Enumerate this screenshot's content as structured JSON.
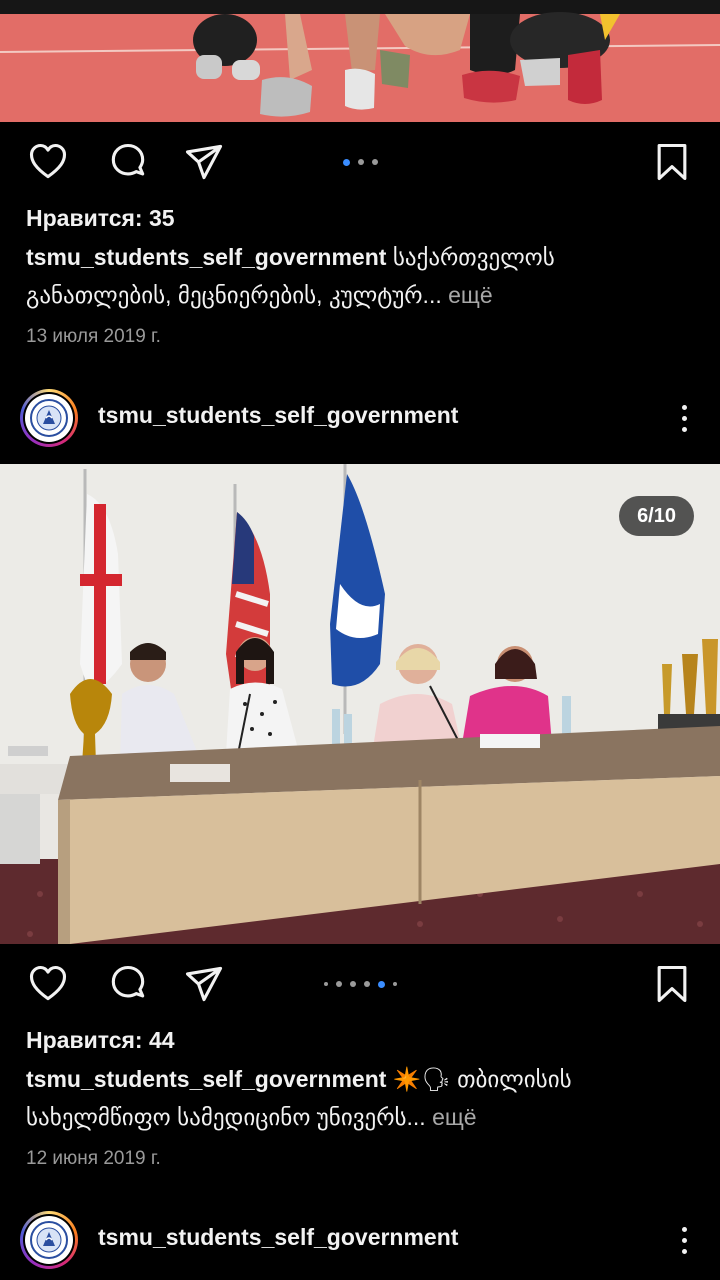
{
  "posts": [
    {
      "likes": "Нравится: 35",
      "username": "tsmu_students_self_government",
      "caption_text": "საქართველოს განათლების, მეცნიერების, კულტურ...",
      "more_label": "ещё",
      "date": "13 июля 2019 г.",
      "carousel": {
        "count": 3,
        "active": 1
      }
    },
    {
      "header_username": "tsmu_students_self_government",
      "photo_counter": "6/10",
      "likes": "Нравится: 44",
      "username": "tsmu_students_self_government",
      "caption_emoji": "✴️🗣",
      "caption_text": "თბილისის სახელმწიფო სამედიცინო უნივერს...",
      "more_label": "ещё",
      "date": "12 июня 2019 г.",
      "carousel": {
        "count": 6,
        "active": 5
      }
    },
    {
      "header_username": "tsmu_students_self_government"
    }
  ],
  "icons": {
    "like": "heart-icon",
    "comment": "comment-icon",
    "share": "send-icon",
    "save": "bookmark-icon",
    "more": "more-vertical-icon"
  },
  "colors": {
    "background": "#000000",
    "text": "#f2f2f2",
    "muted": "#9a9a9a",
    "carousel_active": "#3a8dff"
  }
}
